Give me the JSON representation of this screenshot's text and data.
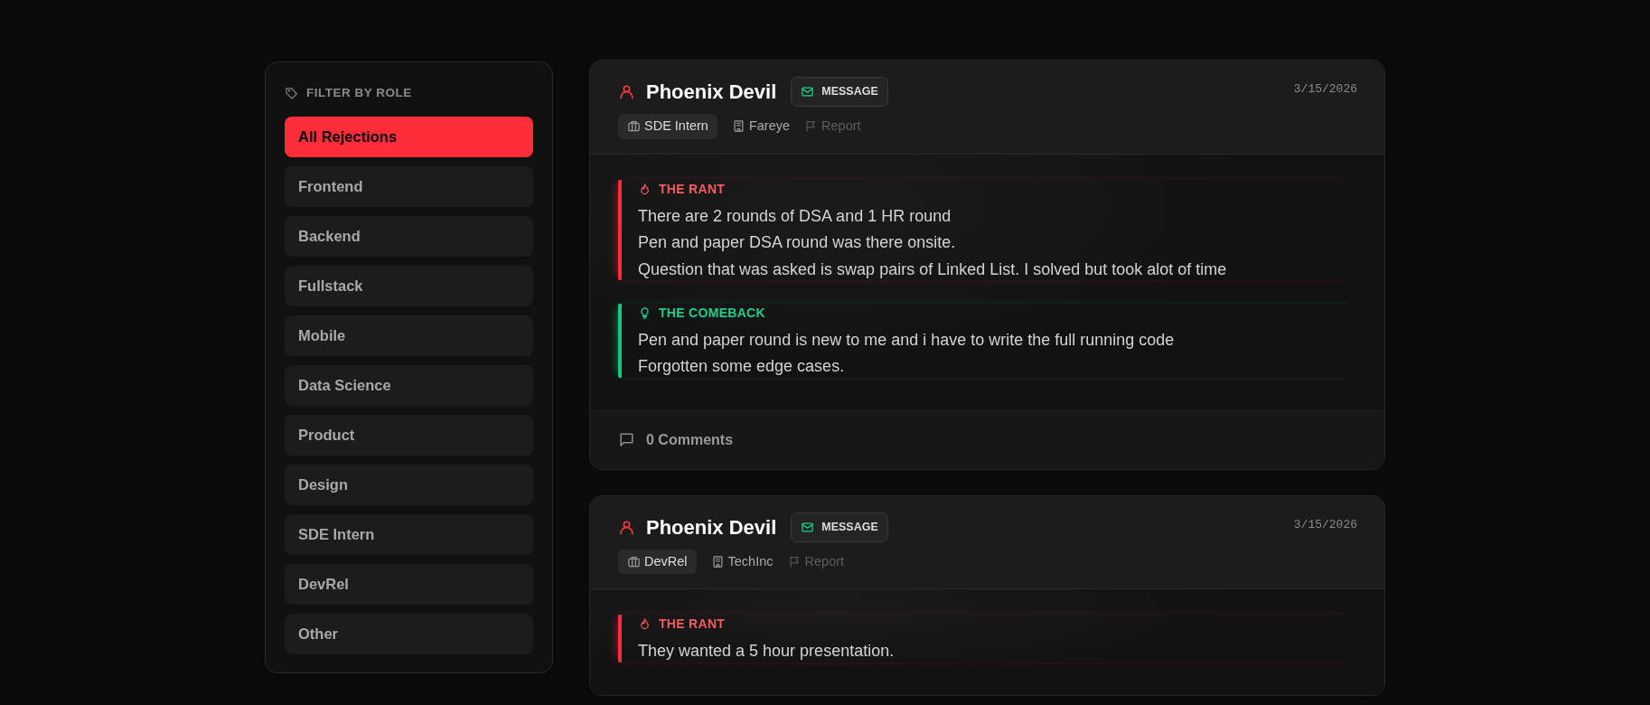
{
  "sidebar": {
    "heading": "FILTER BY ROLE",
    "items": [
      {
        "label": "All Rejections",
        "selected": true
      },
      {
        "label": "Frontend",
        "selected": false
      },
      {
        "label": "Backend",
        "selected": false
      },
      {
        "label": "Fullstack",
        "selected": false
      },
      {
        "label": "Mobile",
        "selected": false
      },
      {
        "label": "Data Science",
        "selected": false
      },
      {
        "label": "Product",
        "selected": false
      },
      {
        "label": "Design",
        "selected": false
      },
      {
        "label": "SDE Intern",
        "selected": false
      },
      {
        "label": "DevRel",
        "selected": false
      },
      {
        "label": "Other",
        "selected": false
      }
    ]
  },
  "posts": [
    {
      "author": "Phoenix Devil",
      "message_button": "MESSAGE",
      "role": "SDE Intern",
      "company": "Fareye",
      "report": "Report",
      "date": "3/15/2026",
      "sections": [
        {
          "kind": "rant",
          "title": "THE RANT",
          "lines": [
            "There are 2 rounds of DSA and 1 HR round",
            "Pen and paper DSA round was there onsite.",
            "Question that was asked is swap pairs of Linked List. I solved but took alot of time"
          ]
        },
        {
          "kind": "comeback",
          "title": "THE COMEBACK",
          "lines": [
            "Pen and paper round is new to me and i have to write the full running code",
            "Forgotten some edge cases."
          ]
        }
      ],
      "comments": "0 Comments"
    },
    {
      "author": "Phoenix Devil",
      "message_button": "MESSAGE",
      "role": "DevRel",
      "company": "TechInc",
      "report": "Report",
      "date": "3/15/2026",
      "sections": [
        {
          "kind": "rant",
          "title": "THE RANT",
          "lines": [
            "They wanted a 5 hour presentation."
          ]
        }
      ]
    }
  ]
}
